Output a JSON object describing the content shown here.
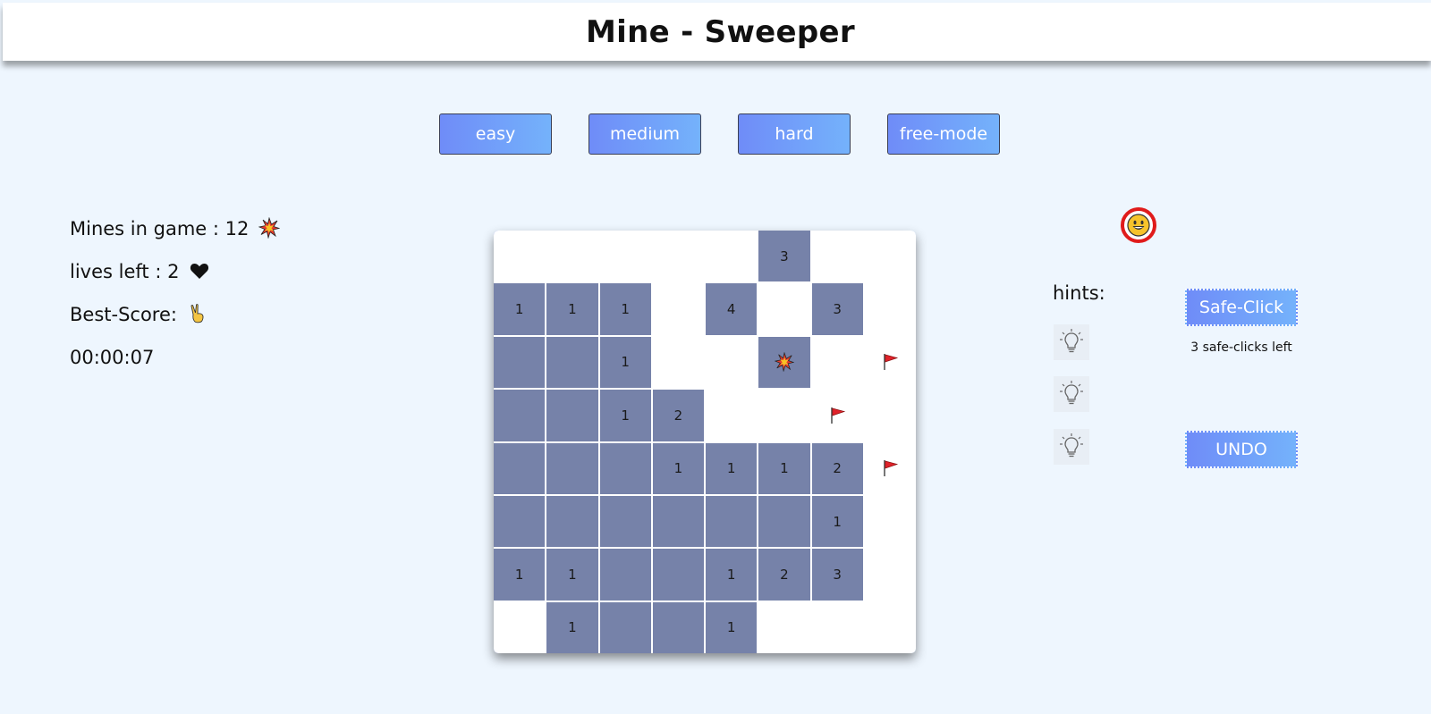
{
  "header": {
    "title": "Mine - Sweeper"
  },
  "levels": [
    {
      "label": "easy"
    },
    {
      "label": "medium"
    },
    {
      "label": "hard"
    },
    {
      "label": "free-mode"
    }
  ],
  "stats": {
    "mines_label": "Mines in game : 12",
    "lives_label": "lives left : 2",
    "best_score_label": "Best-Score:",
    "timer": "00:00:07"
  },
  "board": {
    "rows": [
      [
        {
          "s": "h",
          "v": ""
        },
        {
          "s": "h",
          "v": ""
        },
        {
          "s": "h",
          "v": ""
        },
        {
          "s": "h",
          "v": ""
        },
        {
          "s": "h",
          "v": ""
        },
        {
          "s": "r",
          "v": "3"
        },
        {
          "s": "h",
          "v": ""
        },
        {
          "s": "h",
          "v": ""
        }
      ],
      [
        {
          "s": "r",
          "v": "1"
        },
        {
          "s": "r",
          "v": "1"
        },
        {
          "s": "r",
          "v": "1"
        },
        {
          "s": "h",
          "v": ""
        },
        {
          "s": "r",
          "v": "4"
        },
        {
          "s": "h",
          "v": ""
        },
        {
          "s": "r",
          "v": "3"
        },
        {
          "s": "h",
          "v": ""
        }
      ],
      [
        {
          "s": "r",
          "v": ""
        },
        {
          "s": "r",
          "v": ""
        },
        {
          "s": "r",
          "v": "1"
        },
        {
          "s": "h",
          "v": ""
        },
        {
          "s": "h",
          "v": ""
        },
        {
          "s": "r",
          "v": "",
          "icon": "explosion-icon"
        },
        {
          "s": "h",
          "v": ""
        },
        {
          "s": "h",
          "v": "",
          "icon": "flag-icon"
        }
      ],
      [
        {
          "s": "r",
          "v": ""
        },
        {
          "s": "r",
          "v": ""
        },
        {
          "s": "r",
          "v": "1"
        },
        {
          "s": "r",
          "v": "2"
        },
        {
          "s": "h",
          "v": ""
        },
        {
          "s": "h",
          "v": ""
        },
        {
          "s": "h",
          "v": "",
          "icon": "flag-icon"
        },
        {
          "s": "h",
          "v": ""
        }
      ],
      [
        {
          "s": "r",
          "v": ""
        },
        {
          "s": "r",
          "v": ""
        },
        {
          "s": "r",
          "v": ""
        },
        {
          "s": "r",
          "v": "1"
        },
        {
          "s": "r",
          "v": "1"
        },
        {
          "s": "r",
          "v": "1"
        },
        {
          "s": "r",
          "v": "2"
        },
        {
          "s": "h",
          "v": "",
          "icon": "flag-icon"
        }
      ],
      [
        {
          "s": "r",
          "v": ""
        },
        {
          "s": "r",
          "v": ""
        },
        {
          "s": "r",
          "v": ""
        },
        {
          "s": "r",
          "v": ""
        },
        {
          "s": "r",
          "v": ""
        },
        {
          "s": "r",
          "v": ""
        },
        {
          "s": "r",
          "v": "1"
        },
        {
          "s": "h",
          "v": ""
        }
      ],
      [
        {
          "s": "r",
          "v": "1"
        },
        {
          "s": "r",
          "v": "1"
        },
        {
          "s": "r",
          "v": ""
        },
        {
          "s": "r",
          "v": ""
        },
        {
          "s": "r",
          "v": "1"
        },
        {
          "s": "r",
          "v": "2"
        },
        {
          "s": "r",
          "v": "3"
        },
        {
          "s": "h",
          "v": ""
        }
      ],
      [
        {
          "s": "h",
          "v": ""
        },
        {
          "s": "r",
          "v": "1"
        },
        {
          "s": "r",
          "v": ""
        },
        {
          "s": "r",
          "v": ""
        },
        {
          "s": "r",
          "v": "1"
        },
        {
          "s": "h",
          "v": ""
        },
        {
          "s": "h",
          "v": ""
        },
        {
          "s": "h",
          "v": ""
        }
      ]
    ]
  },
  "sidebar": {
    "hints_label": "hints:",
    "safe_click_label": "Safe-Click",
    "safe_clicks_left": "3 safe-clicks left",
    "undo_label": "UNDO"
  },
  "colors": {
    "accent": "#6f8cf8",
    "smiley_ring": "#e01b1b",
    "flag": "#e0222a"
  }
}
